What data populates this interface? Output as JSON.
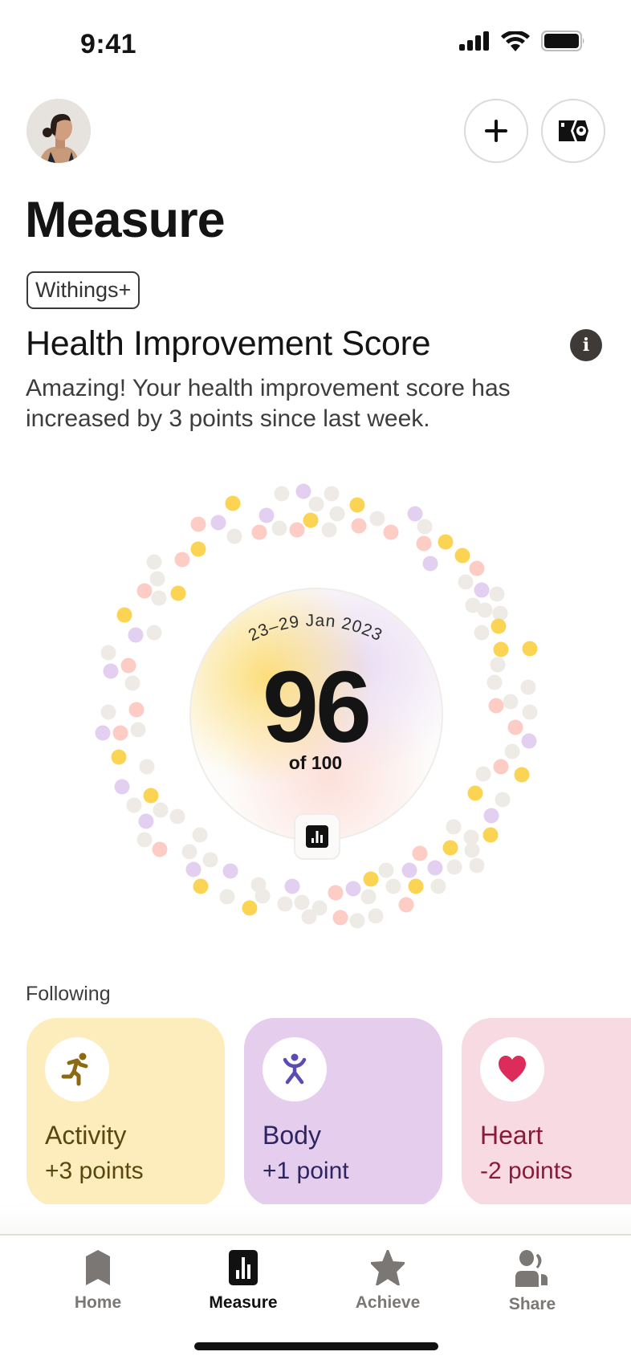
{
  "status_bar": {
    "time": "9:41",
    "icons": [
      "cellular-signal-icon",
      "wifi-icon",
      "battery-icon"
    ]
  },
  "header": {
    "avatar_alt": "User profile photo",
    "add_button_icon": "plus-icon",
    "devices_button_icon": "scale-watch-device-icon"
  },
  "page": {
    "title": "Measure",
    "badge": "Withings+"
  },
  "score_section": {
    "heading": "Health Improvement Score",
    "info_icon": "i",
    "description": "Amazing! Your health improvement score has increased by 3 points since last week.",
    "date_range": "23–29 Jan 2023",
    "score": "96",
    "score_suffix": "of 100",
    "score_value": 96,
    "score_max": 100,
    "chart_button_icon": "bar-chart-icon",
    "dot_colors": {
      "activity": "#FCD453",
      "heart": "#FDCCC5",
      "body": "#E3CFF0",
      "neutral": "#EEEBE6"
    }
  },
  "following": {
    "label": "Following",
    "cards": [
      {
        "title": "Activity",
        "value": "+3 points",
        "icon": "running-person-icon",
        "bg": "#FDEDBC",
        "fg": "#5A4710",
        "icon_color": "#8C6A14"
      },
      {
        "title": "Body",
        "value": "+1 point",
        "icon": "person-arms-up-icon",
        "bg": "#E5CDEE",
        "fg": "#2E2560",
        "icon_color": "#5B4BB3"
      },
      {
        "title": "Heart",
        "value": "-2 points",
        "icon": "heart-icon",
        "bg": "#F8DBE2",
        "fg": "#8A1A3C",
        "icon_color": "#DD2C5C"
      }
    ]
  },
  "tabbar": {
    "tabs": [
      {
        "label": "Home",
        "icon": "bookmark-home-icon",
        "active": false
      },
      {
        "label": "Measure",
        "icon": "bar-chart-icon",
        "active": true
      },
      {
        "label": "Achieve",
        "icon": "star-icon",
        "active": false
      },
      {
        "label": "Share",
        "icon": "people-icon",
        "active": false
      }
    ]
  }
}
